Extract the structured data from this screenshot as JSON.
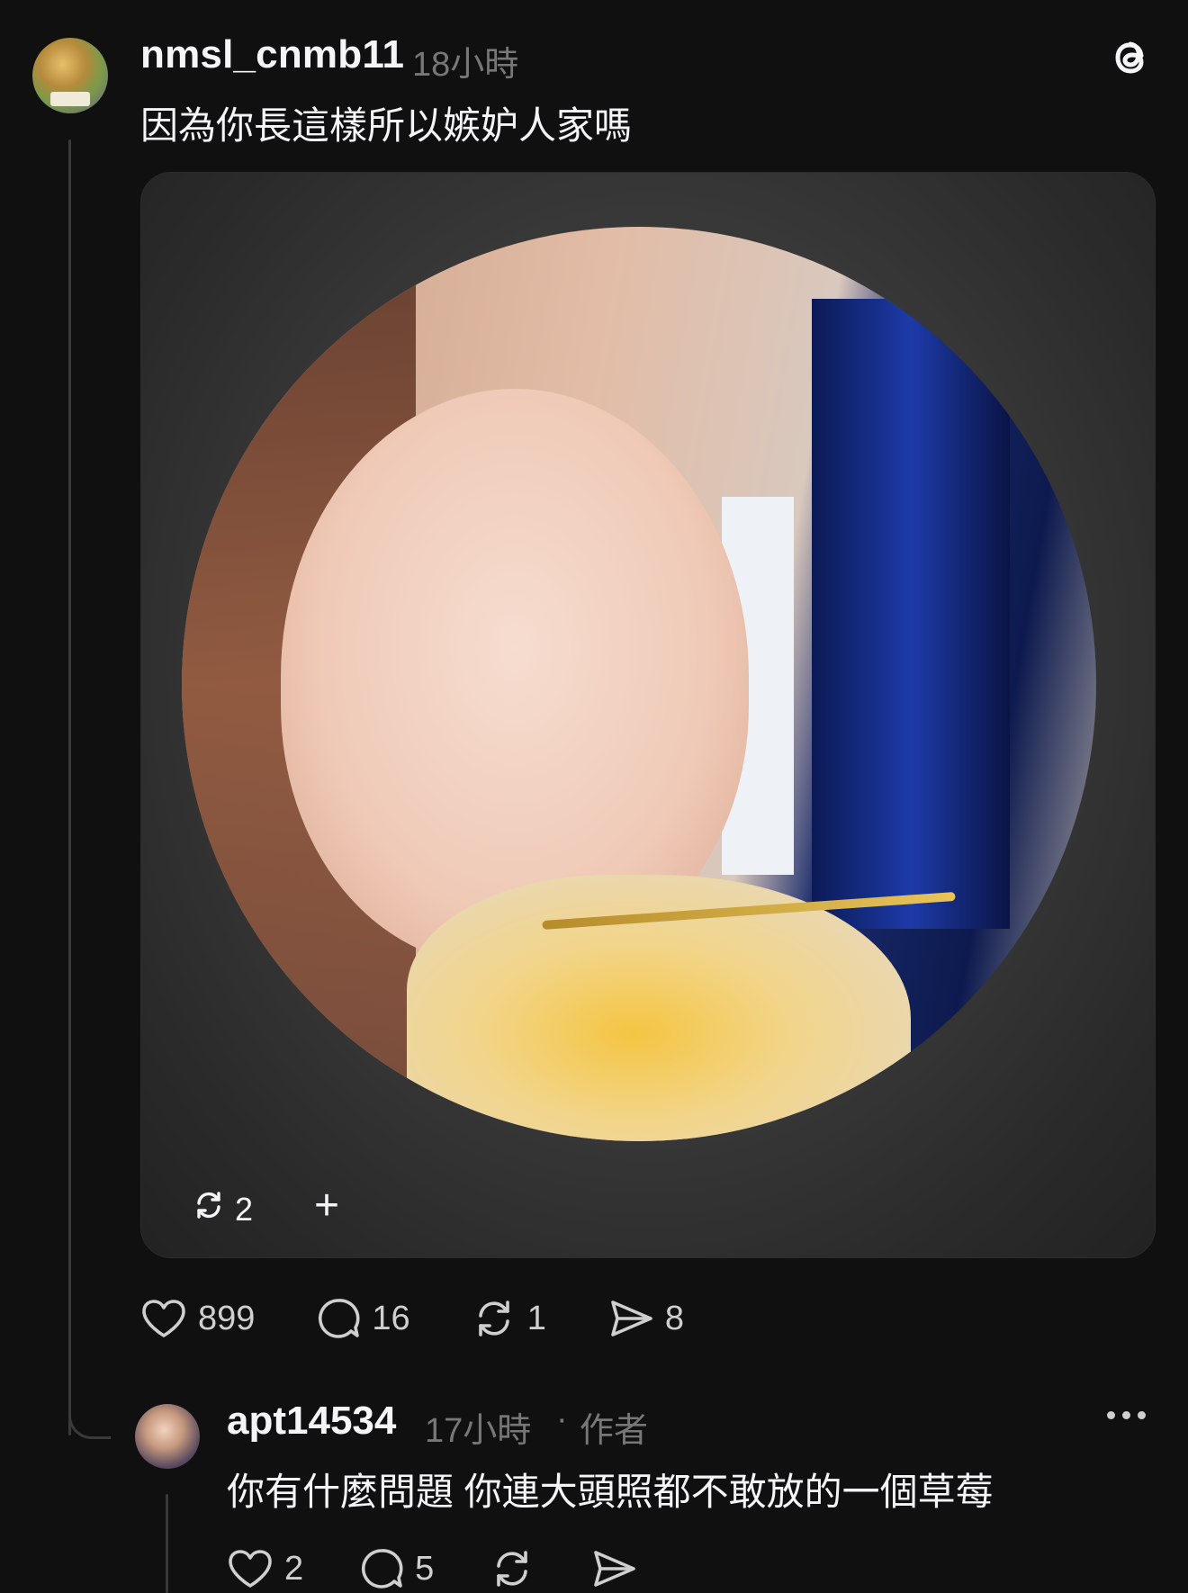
{
  "post": {
    "username": "nmsl_cnmb11",
    "timestamp": "18小時",
    "text": "因為你長這樣所以嫉妒人家嗎",
    "media": {
      "repost_count": "2",
      "plus": "+"
    },
    "actions": {
      "likes": "899",
      "comments": "16",
      "reposts": "1",
      "shares": "8"
    }
  },
  "reply": {
    "username": "apt14534",
    "timestamp": "17小時",
    "separator": "·",
    "author_label": "作者",
    "text": "你有什麼問題 你連大頭照都不敢放的一個草莓",
    "actions": {
      "likes": "2",
      "comments": "5"
    }
  },
  "icons": {
    "app_logo": "threads-logo-icon",
    "like": "heart-icon",
    "comment": "comment-bubble-icon",
    "repost": "repost-icon",
    "share": "send-icon",
    "more": "more-horizontal-icon"
  },
  "colors": {
    "background": "#101010",
    "text_primary": "#f3f5f7",
    "text_secondary": "#777777"
  }
}
